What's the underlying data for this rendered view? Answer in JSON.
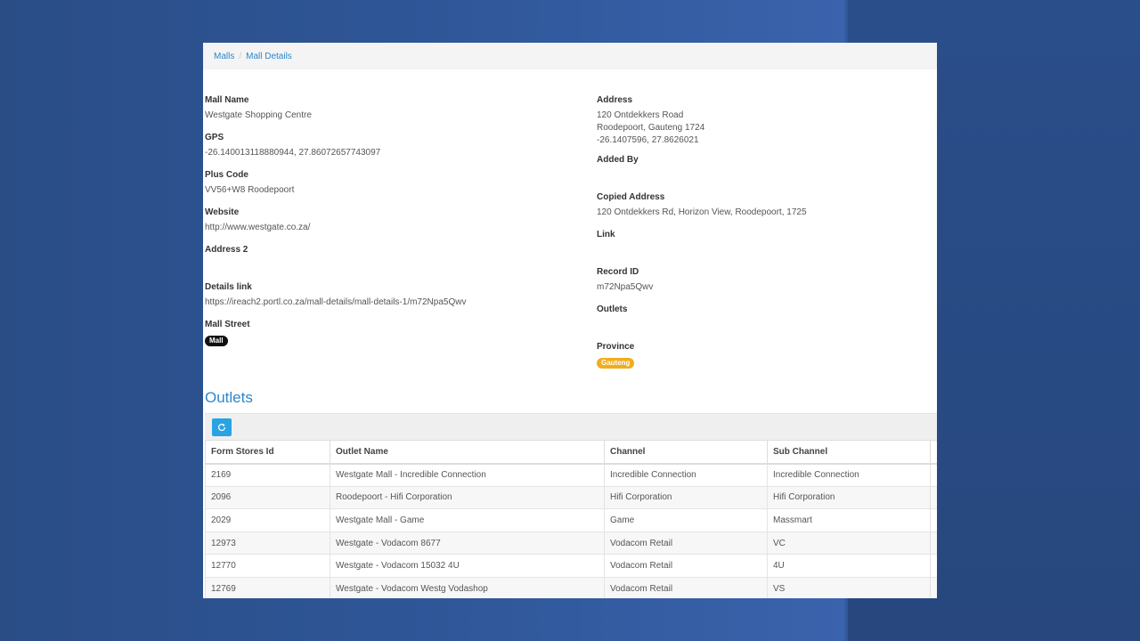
{
  "breadcrumb": {
    "root": "Malls",
    "current": "Mall Details"
  },
  "left_fields": [
    {
      "label": "Mall Name",
      "value": "Westgate Shopping Centre"
    },
    {
      "label": "GPS",
      "value": "-26.140013118880944, 27.86072657743097"
    },
    {
      "label": "Plus Code",
      "value": "VV56+W8 Roodepoort"
    },
    {
      "label": "Website",
      "value": "http://www.westgate.co.za/"
    },
    {
      "label": "Address 2",
      "value": ""
    },
    {
      "label": "Details link",
      "value": "https://ireach2.portl.co.za/mall-details/mall-details-1/m72Npa5Qwv"
    },
    {
      "label": "Mall Street",
      "badge": "Mall"
    }
  ],
  "right_fields": [
    {
      "label": "Address",
      "lines": [
        "120 Ontdekkers Road",
        "Roodepoort, Gauteng 1724",
        "-26.1407596, 27.8626021"
      ]
    },
    {
      "label": "Added By",
      "value": ""
    },
    {
      "label": "Copied Address",
      "value": "120 Ontdekkers Rd, Horizon View, Roodepoort, 1725"
    },
    {
      "label": "Link",
      "value": ""
    },
    {
      "label": "Record ID",
      "value": "m72Npa5Qwv"
    },
    {
      "label": "Outlets",
      "value": ""
    },
    {
      "label": "Province",
      "badge": "Gauteng"
    }
  ],
  "outlets": {
    "title": "Outlets",
    "refresh_icon": "refresh-icon",
    "columns": [
      "Form Stores Id",
      "Outlet Name",
      "Channel",
      "Sub Channel"
    ],
    "rows": [
      [
        "2169",
        "Westgate Mall - Incredible Connection",
        "Incredible Connection",
        "Incredible Connection"
      ],
      [
        "2096",
        "Roodepoort - Hifi Corporation",
        "Hifi Corporation",
        "Hifi Corporation"
      ],
      [
        "2029",
        "Westgate Mall - Game",
        "Game",
        "Massmart"
      ],
      [
        "12973",
        "Westgate - Vodacom 8677",
        "Vodacom Retail",
        "VC"
      ],
      [
        "12770",
        "Westgate - Vodacom 15032 4U",
        "Vodacom Retail",
        "4U"
      ],
      [
        "12769",
        "Westgate - Vodacom Westg Vodashop",
        "Vodacom Retail",
        "VS"
      ]
    ]
  },
  "colors": {
    "link": "#2f86c8",
    "province_badge": "#f0ad1e",
    "mall_badge": "#111111",
    "refresh_button": "#2aa3e3"
  }
}
